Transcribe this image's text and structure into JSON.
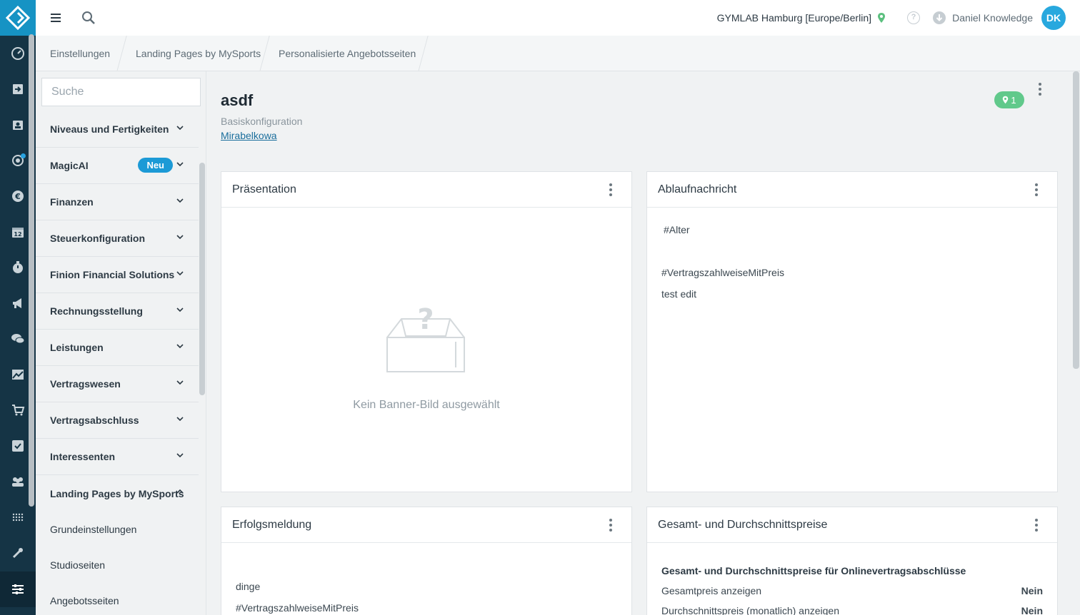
{
  "header": {
    "studio": "GYMLAB Hamburg [Europe/Berlin]",
    "user_name": "Daniel Knowledge",
    "avatar_initials": "DK",
    "help_glyph": "?"
  },
  "breadcrumb": [
    "Einstellungen",
    "Landing Pages by MySports",
    "Personalisierte Angebotsseiten"
  ],
  "sidenav": {
    "search_placeholder": "Suche",
    "items": [
      {
        "label": "Niveaus und Fertigkeiten"
      },
      {
        "label": "MagicAI",
        "badge": "Neu"
      },
      {
        "label": "Finanzen"
      },
      {
        "label": "Steuerkonfiguration"
      },
      {
        "label": "Finion Financial Solutions"
      },
      {
        "label": "Rechnungsstellung"
      },
      {
        "label": "Leistungen"
      },
      {
        "label": "Vertragswesen"
      },
      {
        "label": "Vertragsabschluss"
      },
      {
        "label": "Interessenten"
      },
      {
        "label": "Landing Pages by MySports",
        "expanded": true
      }
    ],
    "subitems": [
      "Grundeinstellungen",
      "Studioseiten",
      "Angebotsseiten"
    ]
  },
  "page": {
    "title": "asdf",
    "subtitle": "Basiskonfiguration",
    "link": "Mirabelkowa",
    "location_count": "1"
  },
  "cards": {
    "presentation": {
      "title": "Präsentation",
      "empty_text": "Kein Banner-Bild ausgewählt",
      "empty_icon": "question-box-icon"
    },
    "expiry": {
      "title": "Ablaufnachricht",
      "lines": [
        "#Alter",
        "#VertragszahlweiseMitPreis",
        "test edit"
      ]
    },
    "success": {
      "title": "Erfolgsmeldung",
      "lines": [
        "dinge",
        "#VertragszahlweiseMitPreis"
      ]
    },
    "prices": {
      "title": "Gesamt- und Durchschnittspreise",
      "section": "Gesamt- und Durchschnittspreise für Onlinevertragsabschlüsse",
      "rows": [
        {
          "label": "Gesamtpreis anzeigen",
          "value": "Nein"
        },
        {
          "label": "Durchschnittspreis (monatlich) anzeigen",
          "value": "Nein"
        }
      ]
    }
  },
  "colors": {
    "rail": "#153445",
    "brand": "#1693c4",
    "badge": "#1c9ad6",
    "location_badge": "#61c98b",
    "avatar": "#28a8de"
  },
  "rail_icons": [
    "dashboard-icon",
    "checkin-icon",
    "contacts-icon",
    "lifecycle-icon",
    "euro-icon",
    "calendar-icon",
    "timer-icon",
    "megaphone-icon",
    "chat-icon",
    "chart-icon",
    "cart-icon",
    "tasks-icon",
    "group-icon",
    "dots-grid-icon",
    "tools-icon",
    "settings-sliders-icon"
  ]
}
